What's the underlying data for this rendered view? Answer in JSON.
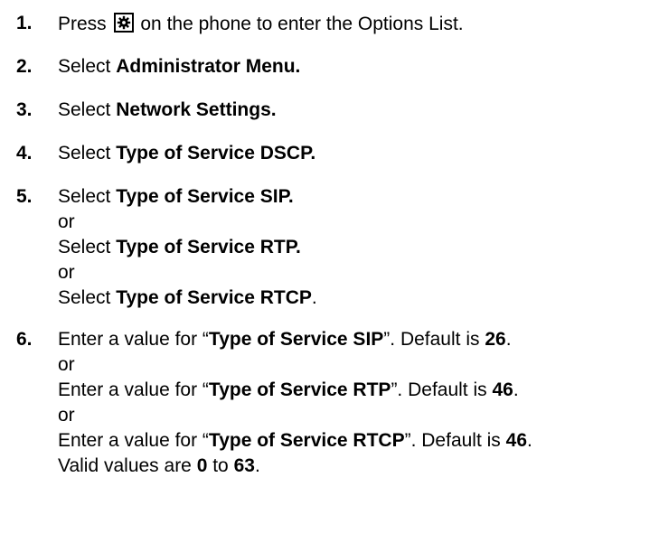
{
  "steps": [
    {
      "number": "1.",
      "text_before": "Press",
      "icon": "gear-icon",
      "text_after": "on the phone to enter the Options List."
    },
    {
      "number": "2.",
      "prefix": "Select",
      "bold": "Administrator Menu."
    },
    {
      "number": "3.",
      "prefix": "Select",
      "bold": "Network Settings."
    },
    {
      "number": "4.",
      "prefix": "Select",
      "bold": "Type of Service DSCP."
    },
    {
      "number": "5.",
      "options": [
        {
          "prefix": "Select",
          "bold": "Type of Service SIP.",
          "suffix": ""
        },
        {
          "prefix": "Select",
          "bold": "Type of Service RTP.",
          "suffix": ""
        },
        {
          "prefix": "Select",
          "bold": "Type of Service RTCP",
          "suffix": "."
        }
      ],
      "or_label": "or"
    },
    {
      "number": "6.",
      "options": [
        {
          "prefix": "Enter a value for “",
          "bold": "Type of Service SIP",
          "middle": "”. Default is ",
          "default": "26",
          "suffix": "."
        },
        {
          "prefix": "Enter a value for “",
          "bold": "Type of Service RTP",
          "middle": "”. Default is ",
          "default": "46",
          "suffix": "."
        },
        {
          "prefix": "Enter a value for “",
          "bold": "Type of Service RTCP",
          "middle": "”. Default is ",
          "default": "46",
          "suffix": "."
        }
      ],
      "or_label": "or",
      "valid": {
        "prefix": "Valid values are ",
        "min": "0",
        "to": " to ",
        "max": "63",
        "suffix": "."
      }
    }
  ]
}
